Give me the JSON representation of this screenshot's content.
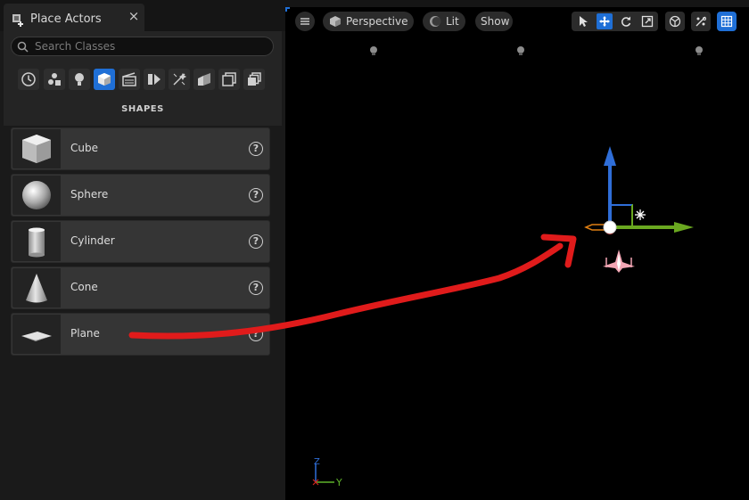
{
  "tab": {
    "title": "Place Actors",
    "close_glyph": "×",
    "icon": "place-actors-icon"
  },
  "search": {
    "placeholder": "Search Classes",
    "value": ""
  },
  "categories": [
    {
      "name": "recent-icon",
      "active": false
    },
    {
      "name": "basic-icon",
      "active": false
    },
    {
      "name": "lights-icon",
      "active": false
    },
    {
      "name": "shapes-icon",
      "active": true
    },
    {
      "name": "cinematic-icon",
      "active": false
    },
    {
      "name": "visual-effects-icon",
      "active": false
    },
    {
      "name": "geometry-icon",
      "active": false
    },
    {
      "name": "volumes-icon",
      "active": false
    },
    {
      "name": "all-classes-icon",
      "active": false
    },
    {
      "name": "more-icon",
      "active": false
    }
  ],
  "section_title": "SHAPES",
  "items": [
    {
      "label": "Cube",
      "icon": "cube-icon",
      "help": "?"
    },
    {
      "label": "Sphere",
      "icon": "sphere-icon",
      "help": "?"
    },
    {
      "label": "Cylinder",
      "icon": "cylinder-icon",
      "help": "?"
    },
    {
      "label": "Cone",
      "icon": "cone-icon",
      "help": "?"
    },
    {
      "label": "Plane",
      "icon": "plane-icon",
      "help": "?"
    }
  ],
  "viewport": {
    "menu_icon": "hamburger-icon",
    "view_mode": "Perspective",
    "lit_label": "Lit",
    "show_label": "Show",
    "axis_labels": {
      "z": "Z",
      "y": "Y"
    },
    "accent_color": "#1f6fd6"
  },
  "annotation": {
    "arrow_color": "#e01b1b",
    "meaning": "drag-arrow"
  }
}
